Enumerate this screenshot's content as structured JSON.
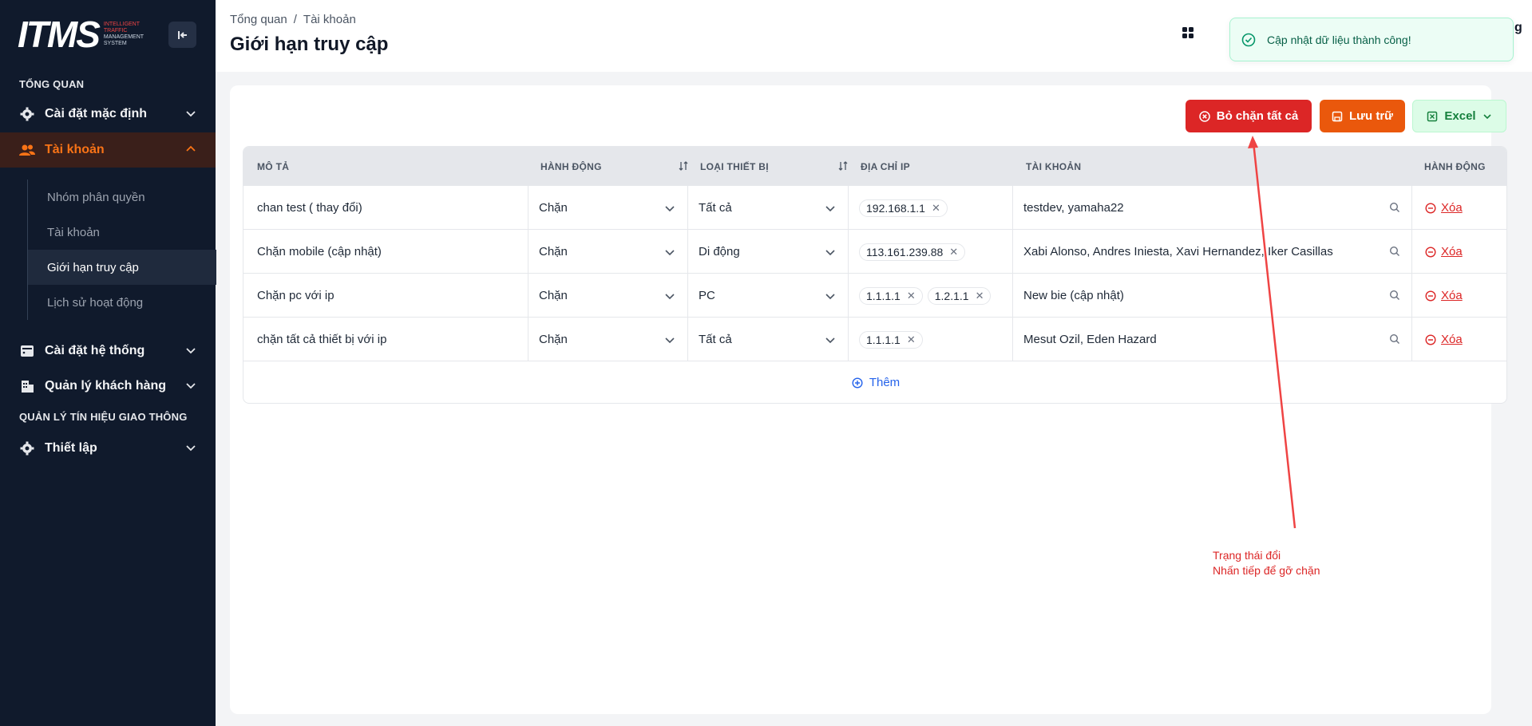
{
  "app": {
    "logo_mark": "ITMS",
    "logo_line1": "INTELLIGENT",
    "logo_line2": "TRAFFIC",
    "logo_line3": "MANAGEMENT",
    "logo_line4": "SYSTEM"
  },
  "sidebar": {
    "section1": "TỔNG QUAN",
    "items": [
      {
        "label": "Cài đặt mặc định",
        "icon": "gear-icon"
      },
      {
        "label": "Tài khoản",
        "icon": "users-icon"
      },
      {
        "label": "Cài đặt hệ thống",
        "icon": "server-icon"
      },
      {
        "label": "Quản lý khách hàng",
        "icon": "building-icon"
      }
    ],
    "sub_items": [
      {
        "label": "Nhóm phân quyền"
      },
      {
        "label": "Tài khoản"
      },
      {
        "label": "Giới hạn truy cập"
      },
      {
        "label": "Lịch sử hoạt động"
      }
    ],
    "section2": "QUẢN LÝ TÍN HIỆU GIAO THÔNG",
    "setup_label": "Thiết lập"
  },
  "header": {
    "breadcrumb_home": "Tổng quan",
    "breadcrumb_sep": "/",
    "breadcrumb_current": "Tài khoản",
    "title": "Giới hạn truy cập",
    "partial_text": "g"
  },
  "toast": {
    "message": "Cập nhật dữ liệu thành công!"
  },
  "toolbar": {
    "unblock_all": "Bỏ chặn tất cả",
    "save": "Lưu trữ",
    "excel": "Excel"
  },
  "table": {
    "headers": {
      "description": "MÔ TẢ",
      "action": "HÀNH ĐỘNG",
      "device_type": "LOẠI THIẾT BỊ",
      "ip": "ĐỊA CHỈ IP",
      "account": "TÀI KHOẢN",
      "row_action": "HÀNH ĐỘNG"
    },
    "rows": [
      {
        "description": "chan test ( thay đổi)",
        "action": "Chặn",
        "device": "Tất cả",
        "ips": [
          "192.168.1.1"
        ],
        "accounts": "testdev, yamaha22",
        "delete": "Xóa"
      },
      {
        "description": "Chặn mobile (cập nhật)",
        "action": "Chặn",
        "device": "Di động",
        "ips": [
          "113.161.239.88"
        ],
        "accounts": "Xabi Alonso, Andres Iniesta, Xavi Hernandez, Iker Casillas",
        "delete": "Xóa"
      },
      {
        "description": "Chặn pc với ip",
        "action": "Chặn",
        "device": "PC",
        "ips": [
          "1.1.1.1",
          "1.2.1.1"
        ],
        "accounts": "New bie (cập nhật)",
        "delete": "Xóa"
      },
      {
        "description": "chặn tất cả thiết bị với ip",
        "action": "Chặn",
        "device": "Tất cả",
        "ips": [
          "1.1.1.1"
        ],
        "accounts": "Mesut Ozil, Eden Hazard",
        "delete": "Xóa"
      }
    ],
    "add_label": "Thêm"
  },
  "annotation": {
    "line1": "Trạng thái đổi",
    "line2": "Nhấn tiếp để gỡ chặn"
  },
  "colors": {
    "sidebar_bg": "#101a2c",
    "accent_orange": "#f97316",
    "danger_red": "#dc2626",
    "excel_green": "#15803d"
  }
}
